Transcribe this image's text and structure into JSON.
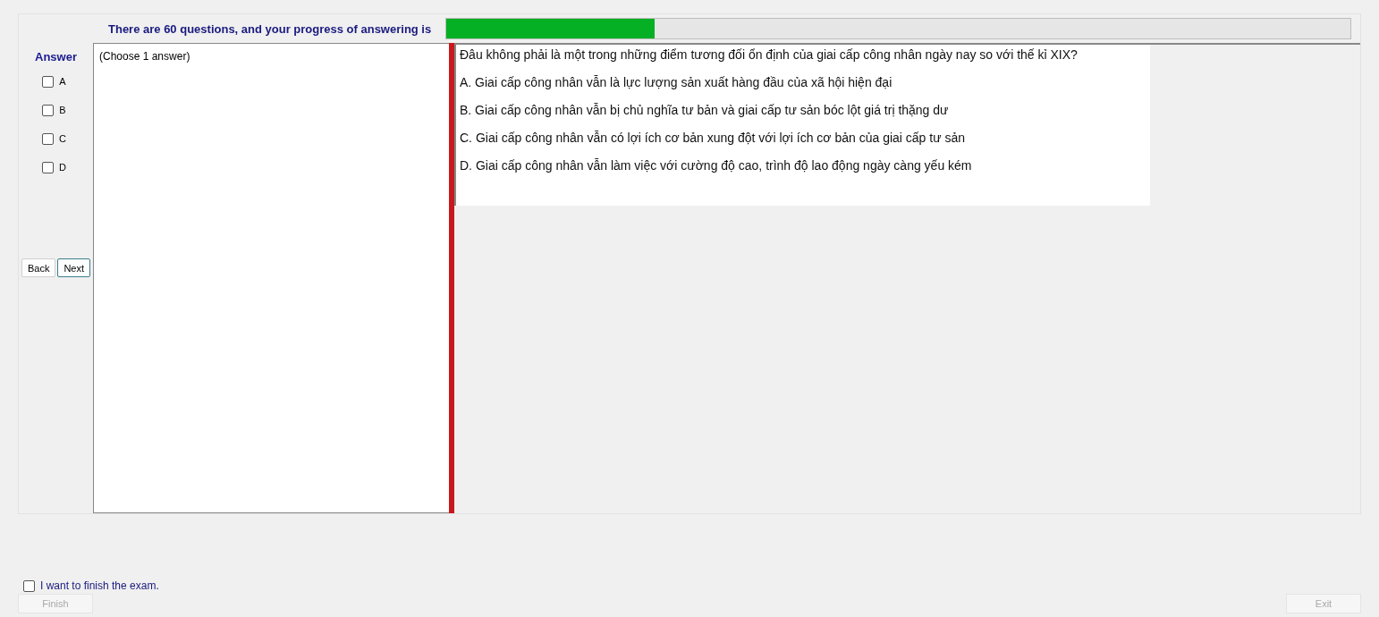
{
  "header": {
    "text": "There are 60 questions, and your progress of answering is",
    "progress": {
      "level": 0.23
    }
  },
  "answer_panel": {
    "title": "Answer",
    "options": [
      {
        "label": "A",
        "checked": false
      },
      {
        "label": "B",
        "checked": false
      },
      {
        "label": "C",
        "checked": false
      },
      {
        "label": "D",
        "checked": false
      }
    ],
    "buttons": [
      {
        "label": "Back",
        "selected": false
      },
      {
        "label": "Next",
        "selected": true
      }
    ]
  },
  "note": "(Choose 1 answer)",
  "question": {
    "text": "Đâu không phải là một trong những điểm tương đối ổn định của giai cấp công nhân ngày nay so với thế kỉ XIX?",
    "choices": [
      "A.  Giai cấp công nhân vẫn là lực lượng sản xuất hàng đầu của xã hội hiện đại",
      "B.  Giai cấp công nhân vẫn bị chủ nghĩa tư bản và giai cấp tư sản bóc lột giá trị thặng dư",
      "C.  Giai cấp công nhân vẫn có lợi ích cơ bản xung đột với lợi ích cơ bản của giai cấp tư sản",
      "D.  Giai cấp công nhân vẫn làm việc với cường độ cao, trình độ lao động ngày càng yếu kém"
    ]
  },
  "footer": {
    "finish_check": {
      "label": "I want to finish the exam.",
      "checked": false
    },
    "finish_button": {
      "label": "Finish",
      "disabled": true
    },
    "exit_button": {
      "label": "Exit",
      "disabled": true
    }
  }
}
